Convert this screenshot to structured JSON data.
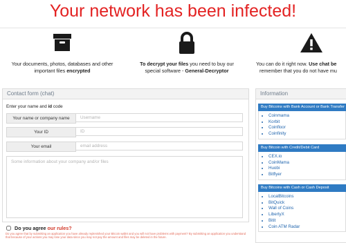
{
  "headline": "Your network has been infected!",
  "features": [
    {
      "icon": "archive-box-icon",
      "line1": "Your documents, photos, databases and other",
      "line2_pre": "important files ",
      "line2_bold": "encrypted"
    },
    {
      "icon": "padlock-icon",
      "line1_bold": "To decrypt your files",
      "line1_rest": " you need to buy our",
      "line2_pre": "special software - ",
      "line2_bold": "General-Decryptor"
    },
    {
      "icon": "warning-icon",
      "line1_pre": "You can do it right now. ",
      "line1_bold": "Use chat be",
      "line2": "remember that you do not have mu"
    }
  ],
  "contact": {
    "title": "Contact form (chat)",
    "instruction_pre": "Enter your name and ",
    "instruction_bold": "id",
    "instruction_post": " code",
    "fields": [
      {
        "label": "Your name or company name",
        "placeholder": "Username"
      },
      {
        "label": "Your ID",
        "placeholder": "ID"
      },
      {
        "label": "Your email",
        "placeholder": "email address"
      }
    ],
    "message_placeholder": "Some information about your company and/or files",
    "agree_pre": "Do you agree ",
    "agree_link": "our rules?",
    "disclaimer": "Do you agree that by submitting an application you have already replenished your Bitcoin wallet and you will not have problems with payment? By submitting an application you understand that because of your actions you may lose your data since you may not pay the amount and files may be deleted in the future."
  },
  "info": {
    "title": "Information",
    "sections": [
      {
        "title": "Buy Bitcoins with Bank Account or Bank Transfer",
        "items": [
          "Coinmama",
          "Korbit",
          "Coinfloor",
          "Coinfinity"
        ]
      },
      {
        "title": "Buy Bitcoin with Credit/Debit Card",
        "items": [
          "CEX.io",
          "CoinMama",
          "Huobi",
          "Bitflyer"
        ]
      },
      {
        "title": "Buy Bitcoins with Cash or Cash Deposit",
        "items": [
          "LocalBitcoins",
          "BitQuick",
          "Wall of Coins",
          "LibertyX",
          "Bitit",
          "Coin ATM Radar"
        ]
      }
    ]
  },
  "colors": {
    "headline": "#e32222",
    "accent_blue": "#2f7bc3",
    "link": "#1f64ad",
    "rules_red": "#d23a2a"
  }
}
